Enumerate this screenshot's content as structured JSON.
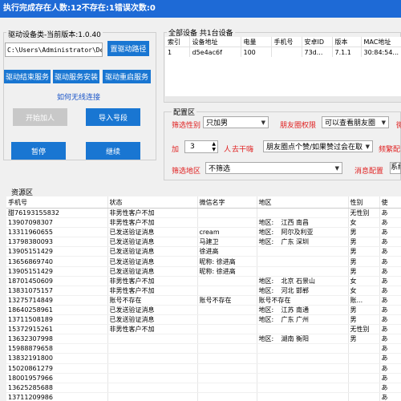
{
  "title": "执行完成存在人数:12不存在:1错误次数:0",
  "driver": {
    "group_label": "驱动设备类-当前版本:1.0.40",
    "path_value": "C:\\Users\\Administrator\\Des",
    "path_button": "置驱动路径",
    "end_service": "驱动结束服务",
    "install_service": "驱动服务安装",
    "restart_service": "驱动重启服务",
    "wireless_link": "如何无线连接",
    "start_add": "开始加人",
    "import_numbers": "导入号段",
    "pause": "暂停",
    "resume": "继续"
  },
  "devices": {
    "group_label": "全部设备 共1台设备",
    "columns": [
      "索引",
      "设备地址",
      "电量",
      "手机号",
      "安卓ID",
      "版本",
      "MAC地址"
    ],
    "rows": [
      [
        "1",
        "d5e4ac6f",
        "100",
        "",
        "73d...",
        "7.1.1",
        "30:84:54..."
      ]
    ]
  },
  "config": {
    "group_label": "配置区",
    "gender_label": "筛选性别",
    "gender_value": "只加男",
    "moments_label": "朋友圈权限",
    "moments_value": "可以查看朋友圈",
    "add_label": "加",
    "add_count": "3",
    "add_unit": "人",
    "intervene_label": "去干嗨",
    "intervene_value": "朋友圈点个赞/如果赞过会在取",
    "tail_label": "频繁配",
    "region_label": "筛选地区",
    "region_value": "不筛选",
    "message_label": "消息配置",
    "message_value": "系统"
  },
  "resources": {
    "group_label": "资源区",
    "columns": [
      "手机号",
      "状态",
      "微信名字",
      "地区",
      "性别",
      "使"
    ],
    "rows": [
      {
        "phone": "甜76193155832",
        "status": "非男性客户不加",
        "wechat": "",
        "region_a": "",
        "region_b": "",
        "gender": "无性别",
        "extra": "あ"
      },
      {
        "phone": "13907098307",
        "status": "非男性客户不加",
        "wechat": "",
        "region_a": "地区:",
        "region_b": "江西 南昌",
        "gender": "女",
        "extra": "あ"
      },
      {
        "phone": "13311960655",
        "status": "已发送验证消息",
        "wechat": "cream",
        "region_a": "地区:",
        "region_b": "阿尔及利亚",
        "gender": "男",
        "extra": "あ"
      },
      {
        "phone": "13798380093",
        "status": "已发送验证消息",
        "wechat": "马建卫",
        "region_a": "地区:",
        "region_b": "广东 深圳",
        "gender": "男",
        "extra": "あ"
      },
      {
        "phone": "13905151429",
        "status": "已发送验证消息",
        "wechat": "徐进高",
        "region_a": "",
        "region_b": "",
        "gender": "男",
        "extra": "あ"
      },
      {
        "phone": "13656869740",
        "status": "已发送验证消息",
        "wechat": "昵称: 徐进高",
        "region_a": "",
        "region_b": "",
        "gender": "男",
        "extra": "あ"
      },
      {
        "phone": "13905151429",
        "status": "已发送验证消息",
        "wechat": "昵称: 徐进高",
        "region_a": "",
        "region_b": "",
        "gender": "男",
        "extra": "あ"
      },
      {
        "phone": "18701450609",
        "status": "非男性客户不加",
        "wechat": "",
        "region_a": "地区:",
        "region_b": "北京 石景山",
        "gender": "女",
        "extra": "あ"
      },
      {
        "phone": "13831075157",
        "status": "非男性客户不加",
        "wechat": "",
        "region_a": "地区:",
        "region_b": "河北 邯郸",
        "gender": "女",
        "extra": "あ"
      },
      {
        "phone": "13275714849",
        "status": "账号不存在",
        "wechat": "账号不存在",
        "region_a": "账号不存在",
        "region_b": "",
        "gender": "账...",
        "extra": "あ"
      },
      {
        "phone": "18640258961",
        "status": "已发送验证消息",
        "wechat": "",
        "region_a": "地区:",
        "region_b": "江苏 南通",
        "gender": "男",
        "extra": "あ"
      },
      {
        "phone": "13711508189",
        "status": "已发送验证消息",
        "wechat": "",
        "region_a": "地区:",
        "region_b": "广东 广州",
        "gender": "男",
        "extra": "あ"
      },
      {
        "phone": "15372915261",
        "status": "非男性客户不加",
        "wechat": "",
        "region_a": "",
        "region_b": "",
        "gender": "无性别",
        "extra": "あ"
      },
      {
        "phone": "13632307998",
        "status": "",
        "wechat": "",
        "region_a": "地区:",
        "region_b": "湖南 衡阳",
        "gender": "男",
        "extra": "あ"
      },
      {
        "phone": "15988879658",
        "status": "",
        "wechat": "",
        "region_a": "",
        "region_b": "",
        "gender": "",
        "extra": "あ"
      },
      {
        "phone": "13832191800",
        "status": "",
        "wechat": "",
        "region_a": "",
        "region_b": "",
        "gender": "",
        "extra": "あ"
      },
      {
        "phone": "15020861279",
        "status": "",
        "wechat": "",
        "region_a": "",
        "region_b": "",
        "gender": "",
        "extra": "あ"
      },
      {
        "phone": "18001957966",
        "status": "",
        "wechat": "",
        "region_a": "",
        "region_b": "",
        "gender": "",
        "extra": "あ"
      },
      {
        "phone": "13625285688",
        "status": "",
        "wechat": "",
        "region_a": "",
        "region_b": "",
        "gender": "",
        "extra": "あ"
      },
      {
        "phone": "13711209986",
        "status": "",
        "wechat": "",
        "region_a": "",
        "region_b": "",
        "gender": "",
        "extra": "あ"
      }
    ]
  },
  "colors": {
    "title_bar": "#1e6ad6",
    "button": "#1976d2",
    "label_red": "#e02020",
    "link": "#1a55c8"
  }
}
